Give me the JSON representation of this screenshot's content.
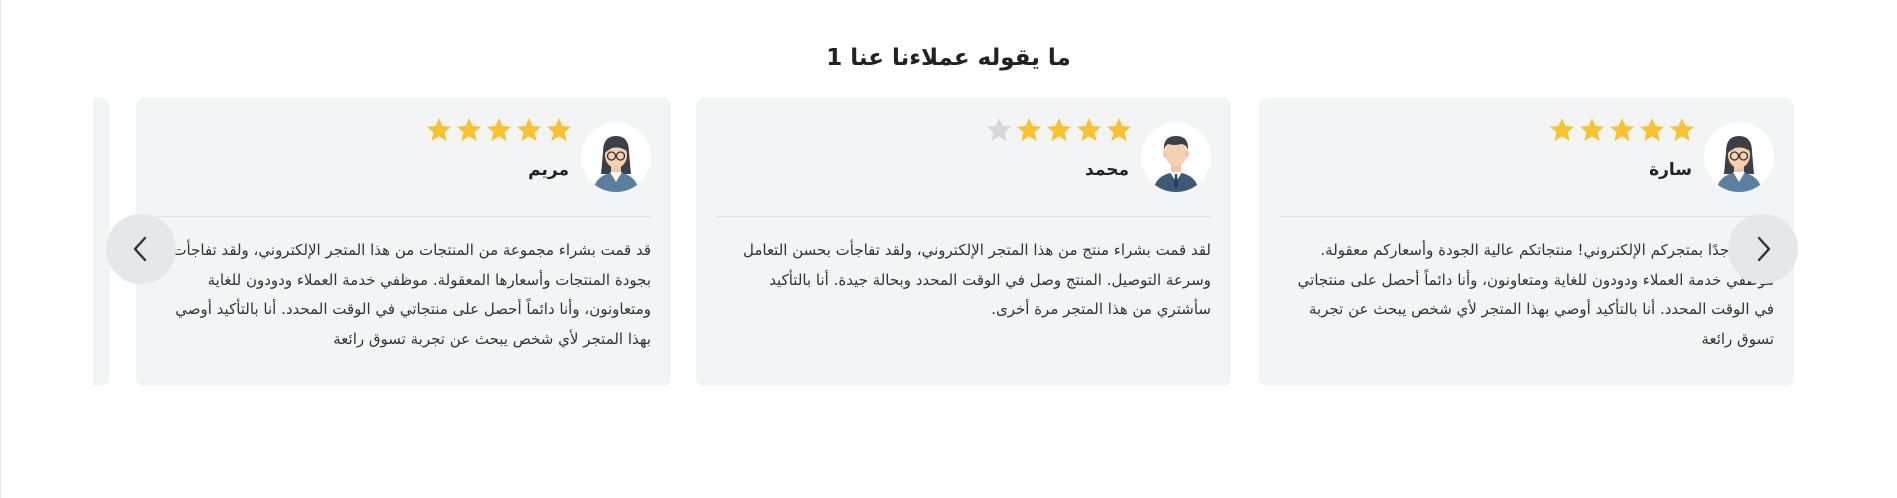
{
  "section": {
    "title": "ما يقوله عملاءنا عنا 1"
  },
  "colors": {
    "star_filled": "#f9c230",
    "star_empty": "#d5d7dc",
    "card_bg": "#f3f4f6"
  },
  "navigation": {
    "prev_icon": "chevron-left-icon",
    "next_icon": "chevron-right-icon"
  },
  "testimonials": [
    {
      "name": "سارة",
      "avatar": "female-avatar",
      "rating": 5,
      "text": "سعيدة جدًا بمتجركم الإلكتروني! منتجاتكم عالية الجودة وأسعاركم معقولة. موظفي خدمة العملاء ودودون للغاية ومتعاونون، وأنا دائماً أحصل على منتجاتي في الوقت المحدد. أنا بالتأكيد أوصي بهذا المتجر لأي شخص يبحث عن تجربة تسوق رائعة"
    },
    {
      "name": "محمد",
      "avatar": "male-avatar",
      "rating": 4,
      "text": "لقد قمت بشراء منتج من هذا المتجر الإلكتروني، ولقد تفاجأت بحسن التعامل وسرعة التوصيل. المنتج وصل في الوقت المحدد وبحالة جيدة. أنا بالتأكيد سأشتري من هذا المتجر مرة أخرى."
    },
    {
      "name": "مريم",
      "avatar": "female-avatar",
      "rating": 5,
      "text": "قد قمت بشراء مجموعة من المنتجات من هذا المتجر الإلكتروني، ولقد تفاجأت بجودة المنتجات وأسعارها المعقولة. موظفي خدمة العملاء ودودون للغاية ومتعاونون، وأنا دائماً أحصل على منتجاتي في الوقت المحدد. أنا بالتأكيد أوصي بهذا المتجر لأي شخص يبحث عن تجربة تسوق رائعة"
    }
  ]
}
